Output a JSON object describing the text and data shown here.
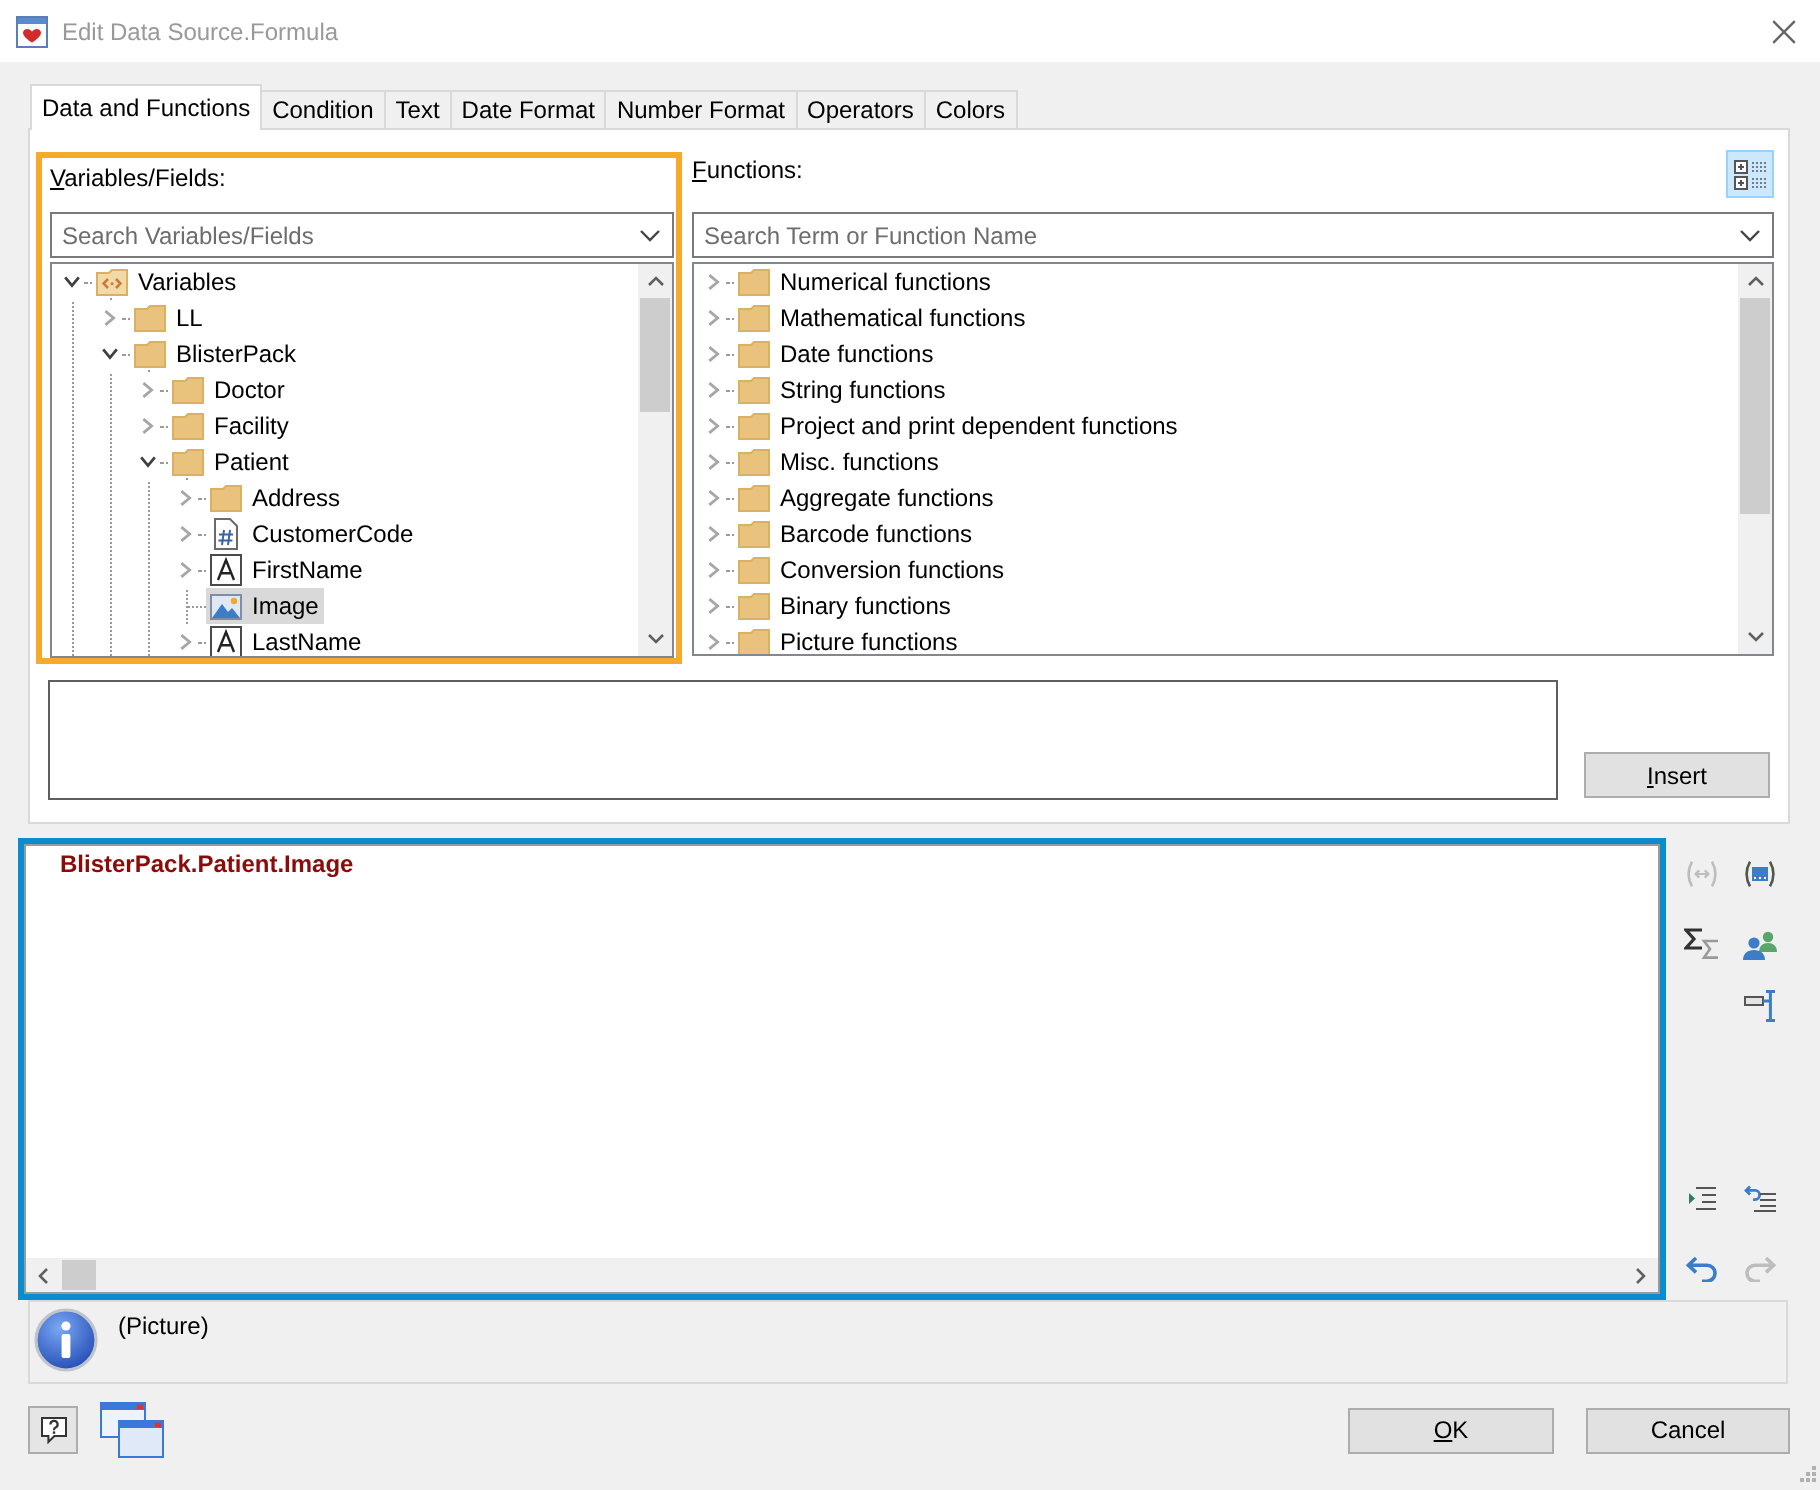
{
  "window": {
    "title": "Edit Data Source.Formula"
  },
  "tabs": [
    {
      "label": "Data and Functions",
      "selected": true
    },
    {
      "label": "Condition",
      "selected": false
    },
    {
      "label": "Text",
      "selected": false
    },
    {
      "label": "Date Format",
      "selected": false
    },
    {
      "label": "Number Format",
      "selected": false
    },
    {
      "label": "Operators",
      "selected": false
    },
    {
      "label": "Colors",
      "selected": false
    }
  ],
  "variables": {
    "label": "Variables/Fields:",
    "access_key_underlined": true,
    "search": {
      "placeholder": "Search Variables/Fields"
    },
    "tree": [
      {
        "label": "Variables",
        "kind": "variables",
        "expanded": true,
        "selected": false,
        "children": [
          {
            "label": "LL",
            "kind": "folder",
            "expanded": false,
            "selected": false
          },
          {
            "label": "BlisterPack",
            "kind": "folder",
            "expanded": true,
            "selected": false,
            "children": [
              {
                "label": "Doctor",
                "kind": "folder",
                "expanded": false,
                "selected": false
              },
              {
                "label": "Facility",
                "kind": "folder",
                "expanded": false,
                "selected": false
              },
              {
                "label": "Patient",
                "kind": "folder",
                "expanded": true,
                "selected": false,
                "children": [
                  {
                    "label": "Address",
                    "kind": "folder",
                    "expanded": false,
                    "selected": false
                  },
                  {
                    "label": "CustomerCode",
                    "kind": "number",
                    "expanded": false,
                    "selected": false
                  },
                  {
                    "label": "FirstName",
                    "kind": "text",
                    "expanded": false,
                    "selected": false
                  },
                  {
                    "label": "Image",
                    "kind": "picture",
                    "selected": true
                  },
                  {
                    "label": "LastName",
                    "kind": "text",
                    "expanded": false,
                    "selected": false
                  }
                ]
              }
            ]
          }
        ]
      }
    ]
  },
  "functions": {
    "label": "Functions:",
    "access_key_underlined": true,
    "view_toggle": {
      "checked": true
    },
    "search": {
      "placeholder": "Search Term or Function Name"
    },
    "items": [
      {
        "label": "Numerical functions",
        "expanded": false,
        "selected": false
      },
      {
        "label": "Mathematical functions",
        "expanded": false,
        "selected": false
      },
      {
        "label": "Date functions",
        "expanded": false,
        "selected": false
      },
      {
        "label": "String functions",
        "expanded": false,
        "selected": false
      },
      {
        "label": "Project and print dependent functions",
        "expanded": false,
        "selected": false
      },
      {
        "label": "Misc. functions",
        "expanded": false,
        "selected": false
      },
      {
        "label": "Aggregate functions",
        "expanded": false,
        "selected": false
      },
      {
        "label": "Barcode functions",
        "expanded": false,
        "selected": false
      },
      {
        "label": "Conversion functions",
        "expanded": false,
        "selected": false
      },
      {
        "label": "Binary functions",
        "expanded": false,
        "selected": false
      },
      {
        "label": "Picture functions",
        "expanded": false,
        "selected": false
      }
    ]
  },
  "insert_button": {
    "label": "Insert",
    "access_key_underlined": true
  },
  "formula": {
    "text": "BlisterPack.Patient.Image"
  },
  "formula_toolbar": [
    {
      "disabled": true
    },
    {
      "disabled": false
    },
    {
      "disabled": false
    },
    {
      "disabled": false
    },
    {
      "disabled": false
    },
    {
      "disabled": false
    },
    {
      "disabled": false
    },
    {
      "disabled": false
    },
    {
      "disabled": true
    }
  ],
  "info": {
    "text": "(Picture)"
  },
  "buttons": [
    {
      "label": "OK",
      "access_key_underlined": true
    },
    {
      "label": "Cancel",
      "access_key_underlined": false
    }
  ]
}
